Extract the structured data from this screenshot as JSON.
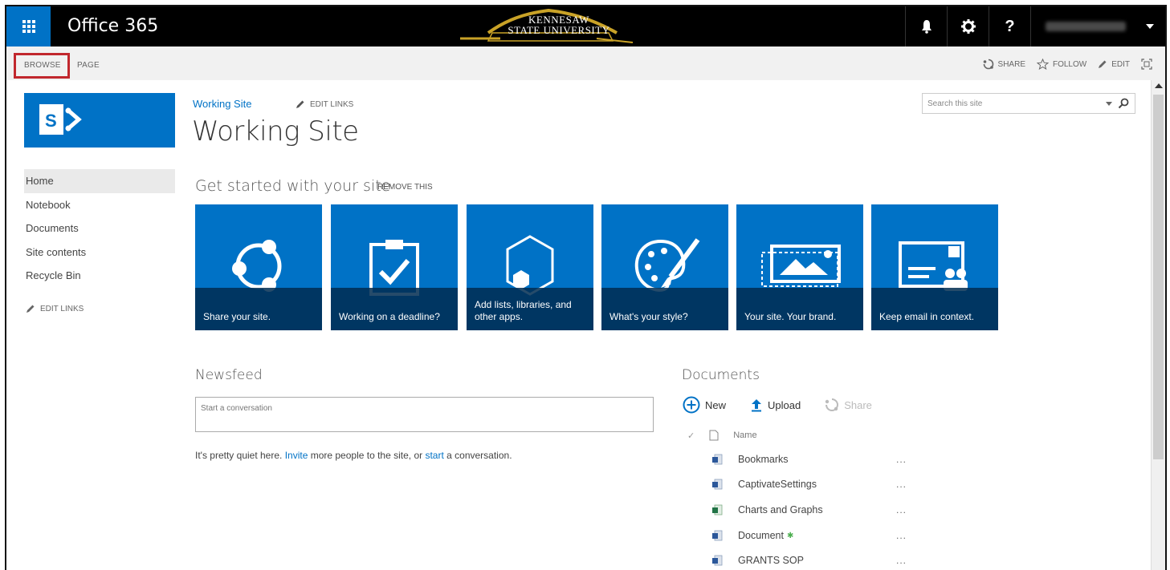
{
  "suitebar": {
    "brand": "Office 365",
    "logo_line1": "KENNESAW",
    "logo_line2": "STATE UNIVERSITY",
    "help_label": "?"
  },
  "ribbon": {
    "tabs": [
      "BROWSE",
      "PAGE"
    ],
    "actions": {
      "share": "SHARE",
      "follow": "FOLLOW",
      "edit": "EDIT"
    }
  },
  "site": {
    "breadcrumb": "Working Site",
    "edit_links": "EDIT LINKS",
    "title": "Working Site"
  },
  "search": {
    "placeholder": "Search this site"
  },
  "nav": {
    "items": [
      "Home",
      "Notebook",
      "Documents",
      "Site contents",
      "Recycle Bin"
    ],
    "edit_links": "EDIT LINKS"
  },
  "getting_started": {
    "title": "Get started with your site",
    "remove": "REMOVE THIS",
    "tiles": [
      {
        "caption": "Share your site."
      },
      {
        "caption": "Working on a deadline?"
      },
      {
        "caption": "Add lists, libraries, and other apps."
      },
      {
        "caption": "What's your style?"
      },
      {
        "caption": "Your site. Your brand."
      },
      {
        "caption": "Keep email in context."
      }
    ]
  },
  "newsfeed": {
    "title": "Newsfeed",
    "placeholder": "Start a conversation",
    "quiet_prefix": "It's pretty quiet here. ",
    "invite_link": "Invite",
    "quiet_middle": " more people to the site, or ",
    "start_link": "start",
    "quiet_suffix": " a conversation."
  },
  "documents": {
    "title": "Documents",
    "toolbar": {
      "new": "New",
      "upload": "Upload",
      "share": "Share"
    },
    "column_name": "Name",
    "items": [
      {
        "name": "Bookmarks",
        "type": "word",
        "new": false
      },
      {
        "name": "CaptivateSettings",
        "type": "word",
        "new": false
      },
      {
        "name": "Charts and Graphs",
        "type": "excel",
        "new": false
      },
      {
        "name": "Document",
        "type": "word",
        "new": true
      },
      {
        "name": "GRANTS SOP",
        "type": "word",
        "new": false
      }
    ],
    "more_label": "..."
  },
  "colors": {
    "accent": "#0072c6",
    "highlight": "#c1272d",
    "suitebar": "#000000"
  }
}
